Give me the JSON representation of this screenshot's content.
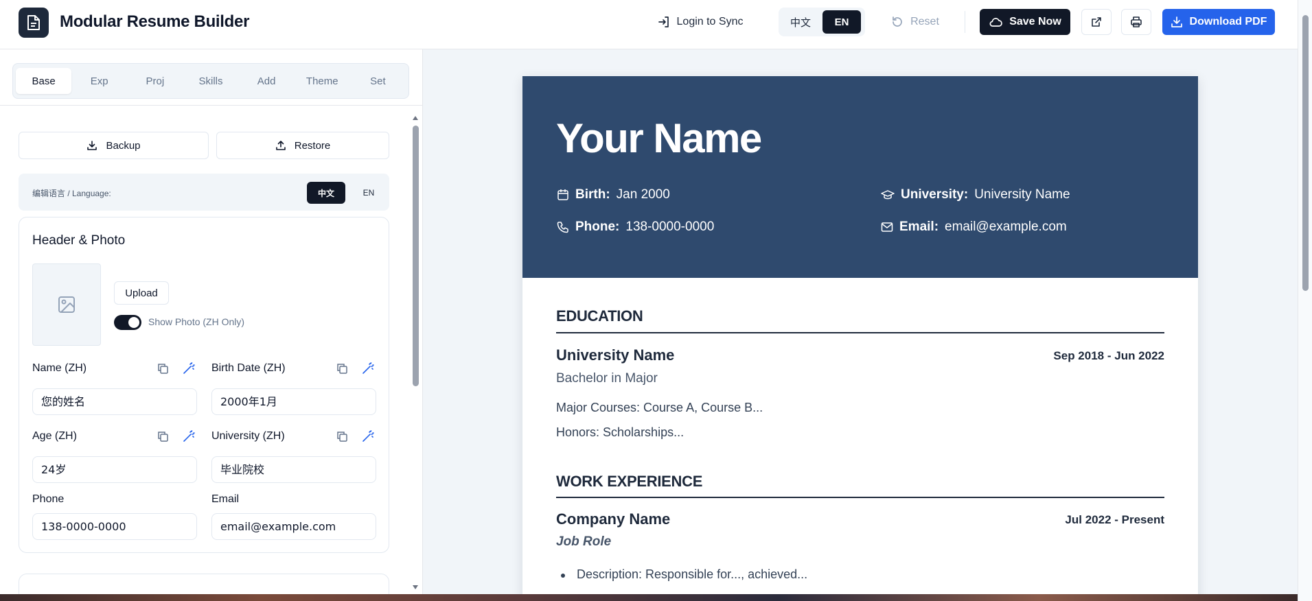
{
  "header": {
    "app_title": "Modular Resume Builder",
    "login_label": "Login to Sync",
    "lang_zh": "中文",
    "lang_en": "EN",
    "active_lang": "EN",
    "reset_label": "Reset",
    "save_label": "Save Now",
    "download_label": "Download PDF"
  },
  "icons": {
    "logo": "document-icon",
    "login": "login-icon",
    "reset": "reset-icon",
    "save": "cloud-icon",
    "external": "external-link-icon",
    "print": "printer-icon",
    "download": "download-icon"
  },
  "sidebar": {
    "tabs": [
      {
        "label": "Base",
        "active": true
      },
      {
        "label": "Exp",
        "active": false
      },
      {
        "label": "Proj",
        "active": false
      },
      {
        "label": "Skills",
        "active": false
      },
      {
        "label": "Add",
        "active": false
      },
      {
        "label": "Theme",
        "active": false
      },
      {
        "label": "Set",
        "active": false
      }
    ],
    "backup_label": "Backup",
    "restore_label": "Restore",
    "edit_language_label": "编辑语言 / Language:",
    "edit_lang_zh": "中文",
    "edit_lang_en": "EN",
    "header_card": {
      "title": "Header & Photo",
      "upload_label": "Upload",
      "show_photo_label": "Show Photo (ZH Only)",
      "show_photo_on": true,
      "fields": {
        "name_zh": {
          "label": "Name (ZH)",
          "value": "您的姓名"
        },
        "birth_zh": {
          "label": "Birth Date (ZH)",
          "value": "2000年1月"
        },
        "age_zh": {
          "label": "Age (ZH)",
          "value": "24岁"
        },
        "university_zh": {
          "label": "University (ZH)",
          "value": "毕业院校"
        },
        "phone": {
          "label": "Phone",
          "value": "138-0000-0000"
        },
        "email": {
          "label": "Email",
          "value": "email@example.com"
        }
      }
    }
  },
  "resume": {
    "name": "Your Name",
    "birth_label": "Birth:",
    "birth_value": "Jan 2000",
    "university_label": "University:",
    "university_value": "University Name",
    "phone_label": "Phone:",
    "phone_value": "138-0000-0000",
    "email_label": "Email:",
    "email_value": "email@example.com",
    "education": {
      "title": "EDUCATION",
      "school": "University Name",
      "dates": "Sep 2018 - Jun 2022",
      "degree": "Bachelor in Major",
      "courses": "Major Courses: Course A, Course B...",
      "honors": "Honors: Scholarships..."
    },
    "work": {
      "title": "WORK EXPERIENCE",
      "company": "Company Name",
      "dates": "Jul 2022 - Present",
      "role": "Job Role",
      "bullet": "Description: Responsible for..., achieved..."
    }
  },
  "colors": {
    "header_bg": "#2f4a6e",
    "primary_dark": "#111827",
    "accent_blue": "#2563eb"
  }
}
